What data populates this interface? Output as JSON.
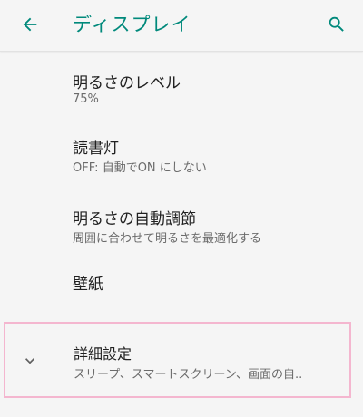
{
  "appbar": {
    "title": "ディスプレイ",
    "back_icon": "arrow-back-icon",
    "search_icon": "search-icon",
    "accent_color": "#00897b"
  },
  "settings": {
    "brightness": {
      "label": "明るさのレベル",
      "summary": "75%"
    },
    "night_light": {
      "label": "読書灯",
      "summary": "OFF: 自動でON にしない"
    },
    "adaptive_brightness": {
      "label": "明るさの自動調節",
      "summary": "周囲に合わせて明るさを最適化する"
    },
    "wallpaper": {
      "label": "壁紙"
    },
    "advanced": {
      "label": "詳細設定",
      "summary": "スリープ、スマートスクリーン、画面の自..",
      "icon": "chevron-down-icon",
      "highlight_color": "#f4b6cf"
    }
  }
}
